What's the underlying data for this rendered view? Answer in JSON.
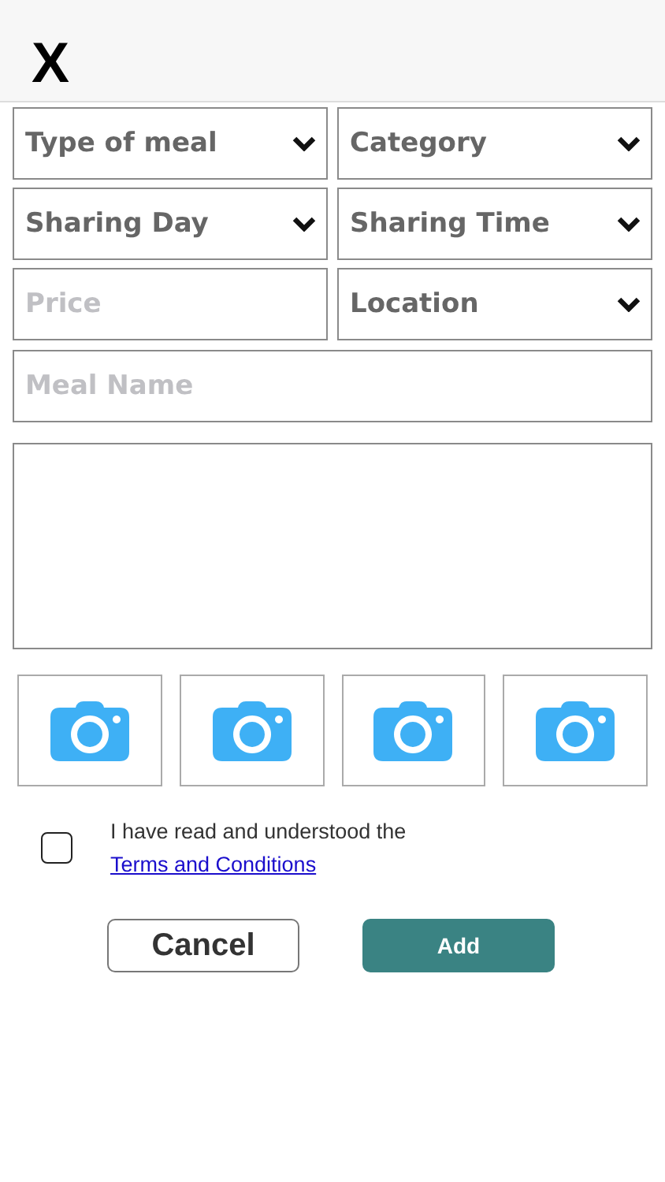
{
  "close_label": "X",
  "fields": [
    {
      "kind": "select",
      "label": "Type of meal"
    },
    {
      "kind": "select",
      "label": "Category"
    },
    {
      "kind": "select",
      "label": "Sharing Day"
    },
    {
      "kind": "select",
      "label": "Sharing Time"
    },
    {
      "kind": "input",
      "placeholder": "Price"
    },
    {
      "kind": "select",
      "label": "Location"
    },
    {
      "kind": "wide_input",
      "placeholder": "Meal Name"
    }
  ],
  "photo_slots": [
    {
      "kind": "camera"
    },
    {
      "kind": "camera"
    },
    {
      "kind": "camera"
    },
    {
      "kind": "camera"
    }
  ],
  "terms": {
    "checked": false,
    "text": "I have read and understood the",
    "link": "Terms and Conditions"
  },
  "buttons": [
    {
      "kind": "secondary",
      "label": "Cancel"
    },
    {
      "kind": "primary",
      "label": "Add"
    }
  ]
}
